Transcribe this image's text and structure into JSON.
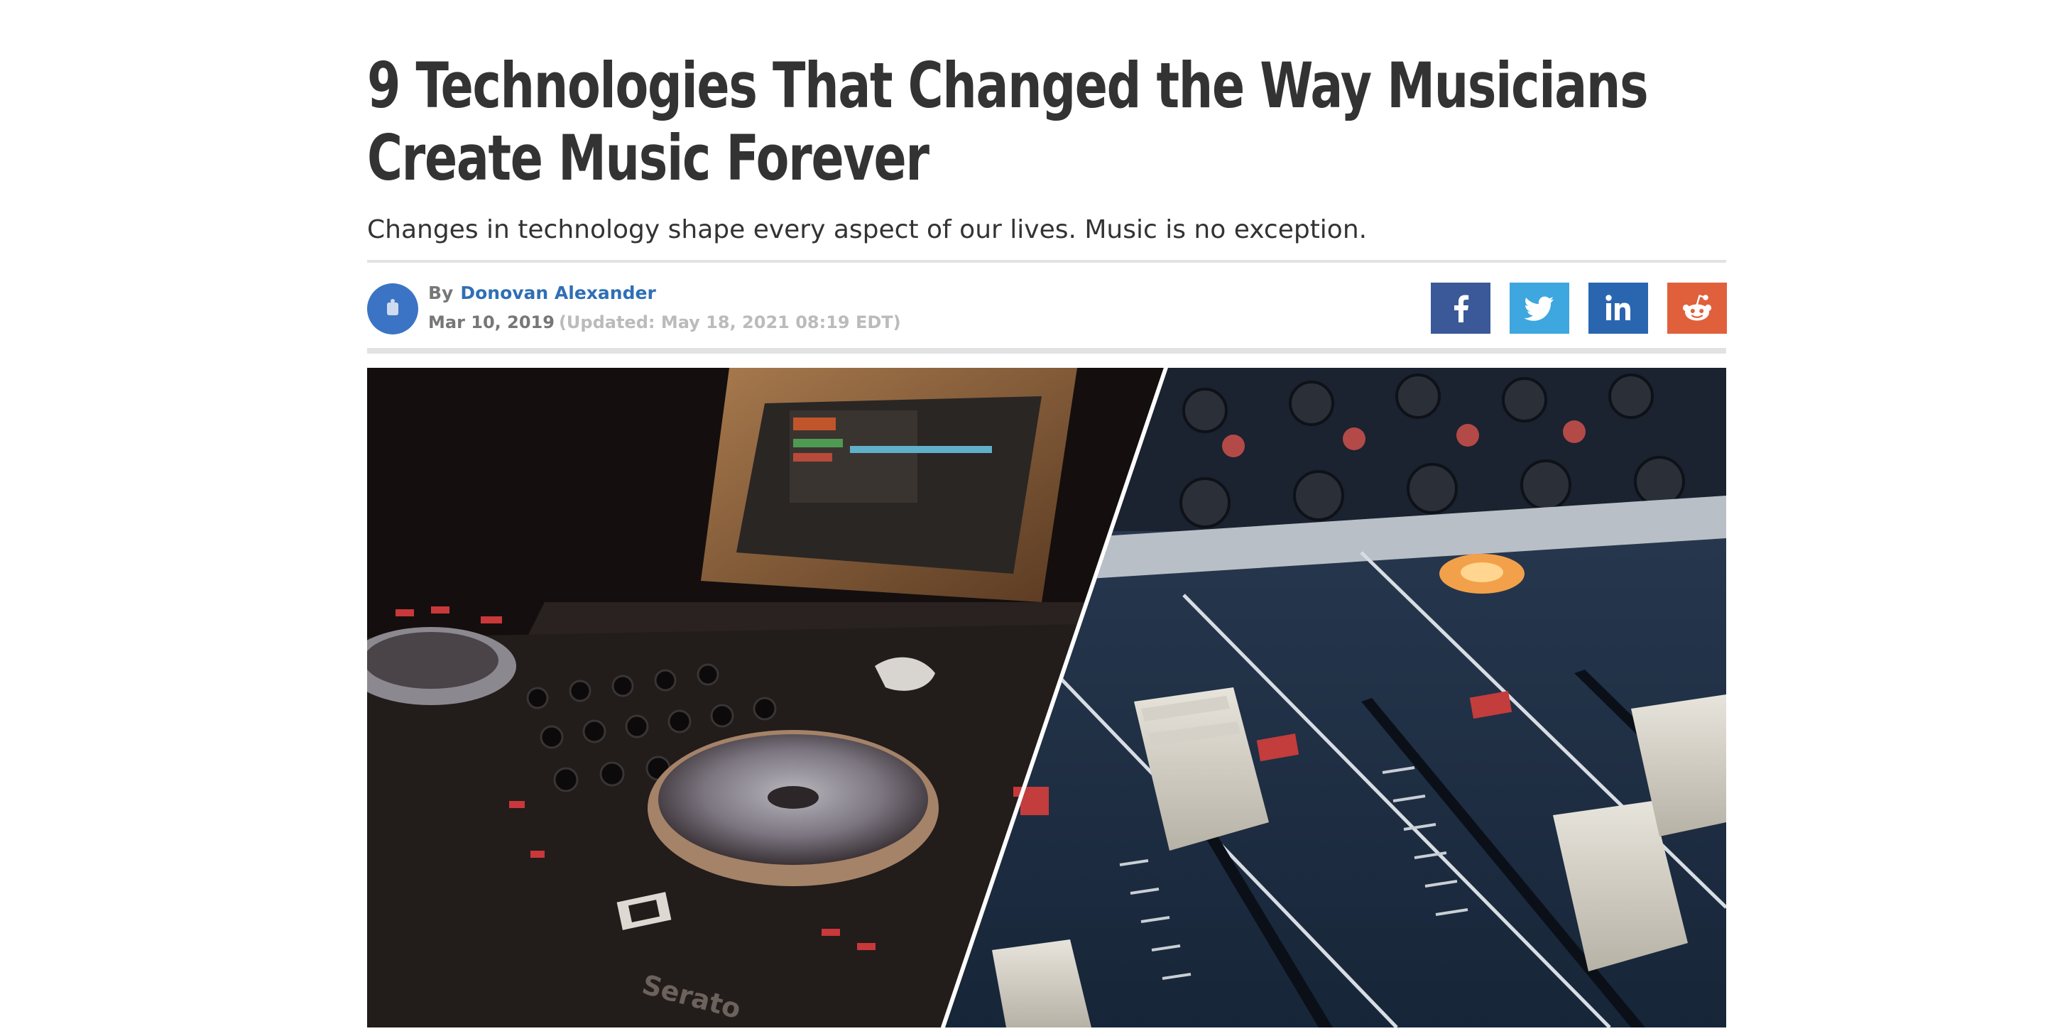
{
  "article": {
    "headline": "9 Technologies That Changed the Way Musicians Create Music Forever",
    "subheadline": "Changes in technology shape every aspect of our lives. Music is no exception."
  },
  "byline": {
    "by_label": "By",
    "author": "Donovan Alexander",
    "date": "Mar 10, 2019",
    "updated": "(Updated: May 18, 2021 08:19 EDT)"
  },
  "share": {
    "icons": [
      "facebook-icon",
      "twitter-icon",
      "linkedin-icon",
      "reddit-icon"
    ]
  },
  "hero_image": {
    "left_mark_text": "Serato"
  },
  "colors": {
    "headline": "#333333",
    "author_link": "#2f6fb5",
    "facebook": "#3b5998",
    "twitter": "#3ea7df",
    "linkedin": "#2a66b0",
    "reddit": "#e0603c"
  }
}
